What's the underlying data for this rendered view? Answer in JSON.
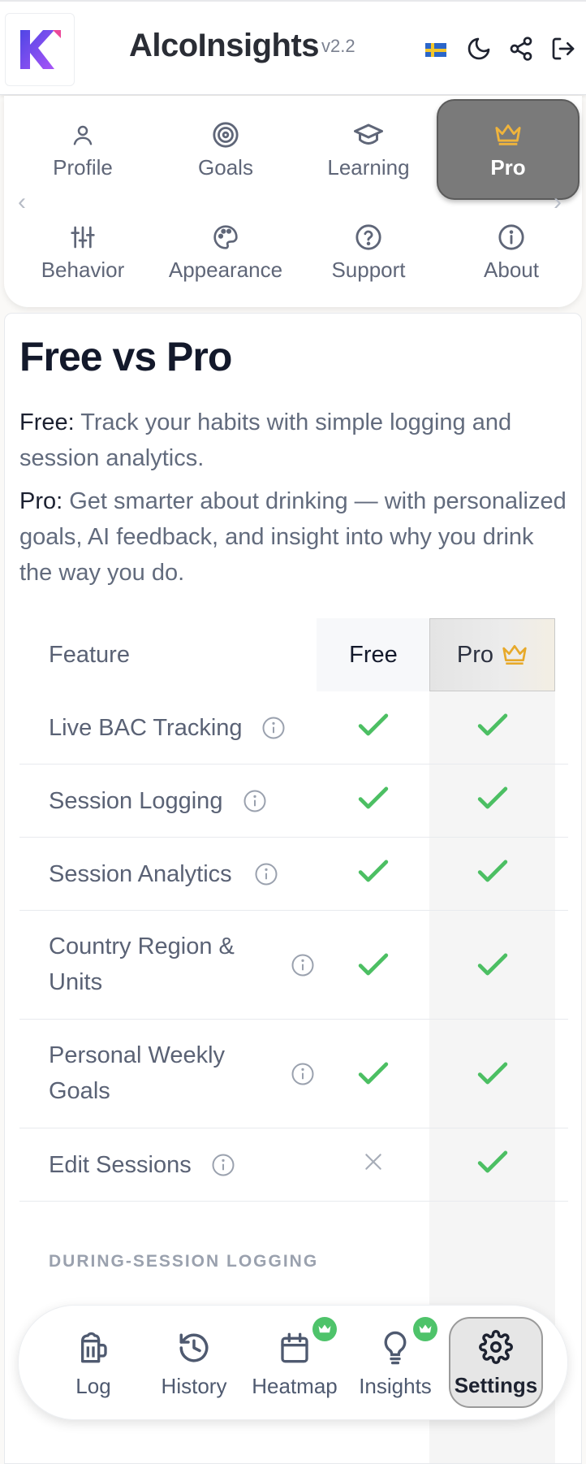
{
  "header": {
    "title": "AlcoInsights",
    "version": "v2.2",
    "icons": [
      "sweden-flag-icon",
      "moon-icon",
      "share-icon",
      "logout-icon"
    ]
  },
  "settings_tabs": [
    {
      "label": "Profile",
      "icon": "user-icon"
    },
    {
      "label": "Goals",
      "icon": "target-icon"
    },
    {
      "label": "Learning",
      "icon": "graduation-cap-icon"
    },
    {
      "label": "Pro",
      "icon": "crown-icon",
      "active": true
    },
    {
      "label": "Behavior",
      "icon": "sliders-icon"
    },
    {
      "label": "Appearance",
      "icon": "palette-icon"
    },
    {
      "label": "Support",
      "icon": "help-icon"
    },
    {
      "label": "About",
      "icon": "info-icon"
    }
  ],
  "main": {
    "title": "Free vs Pro",
    "free_label": "Free:",
    "free_text": "Track your habits with simple logging and session analytics.",
    "pro_label": "Pro:",
    "pro_text": "Get smarter about drinking — with personalized goals, AI feedback, and insight into why you drink the way you do."
  },
  "table": {
    "headers": {
      "feature": "Feature",
      "free": "Free",
      "pro": "Pro"
    },
    "rows": [
      {
        "feature": "Live BAC Tracking",
        "free": true,
        "pro": true
      },
      {
        "feature": "Session Logging",
        "free": true,
        "pro": true
      },
      {
        "feature": "Session Analytics",
        "free": true,
        "pro": true
      },
      {
        "feature": "Country Region & Units",
        "feature_line1": "Country Region &",
        "feature_line2": "Units",
        "free": true,
        "pro": true
      },
      {
        "feature": "Personal Weekly Goals",
        "feature_line1": "Personal Weekly",
        "feature_line2": "Goals",
        "free": true,
        "pro": true
      },
      {
        "feature": "Edit Sessions",
        "free": false,
        "pro": true
      }
    ],
    "section": "DURING-SESSION LOGGING"
  },
  "bottom_nav": [
    {
      "label": "Log",
      "icon": "beer-mug-icon"
    },
    {
      "label": "History",
      "icon": "history-icon"
    },
    {
      "label": "Heatmap",
      "icon": "calendar-icon",
      "pro_badge": true
    },
    {
      "label": "Insights",
      "icon": "lightbulb-icon",
      "pro_badge": true
    },
    {
      "label": "Settings",
      "icon": "gear-icon",
      "active": true
    }
  ],
  "colors": {
    "brand": "#7c3aed",
    "check": "#4cbf63",
    "crown": "#e7a92a",
    "badge": "#4ec36a"
  }
}
